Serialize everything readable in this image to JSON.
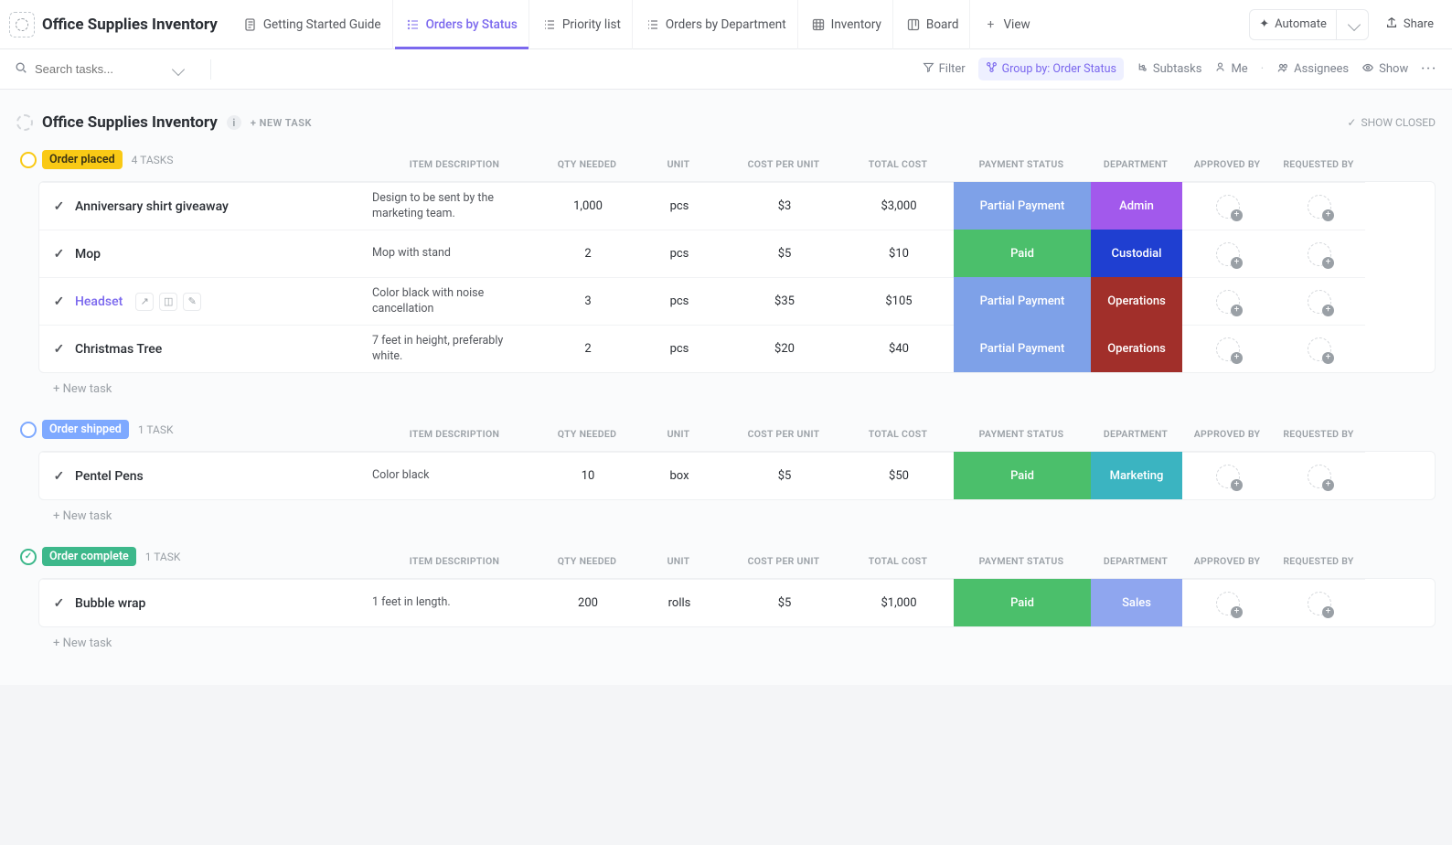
{
  "page_title": "Office Supplies Inventory",
  "tabs": [
    {
      "label": "Getting Started Guide",
      "active": false
    },
    {
      "label": "Orders by Status",
      "active": true
    },
    {
      "label": "Priority list",
      "active": false
    },
    {
      "label": "Orders by Department",
      "active": false
    },
    {
      "label": "Inventory",
      "active": false
    },
    {
      "label": "Board",
      "active": false
    }
  ],
  "add_view_label": "View",
  "top_right": {
    "automate": "Automate",
    "share": "Share"
  },
  "toolbar": {
    "search_placeholder": "Search tasks...",
    "filter": "Filter",
    "group_by": "Group by: Order Status",
    "subtasks": "Subtasks",
    "me": "Me",
    "assignees": "Assignees",
    "show": "Show"
  },
  "list": {
    "title": "Office Supplies Inventory",
    "new_task": "+ NEW TASK",
    "show_closed": "SHOW CLOSED"
  },
  "columns": {
    "name": "",
    "item_description": "ITEM DESCRIPTION",
    "qty_needed": "QTY NEEDED",
    "unit": "UNIT",
    "cost_per_unit": "COST PER UNIT",
    "total_cost": "TOTAL COST",
    "payment_status": "PAYMENT STATUS",
    "department": "DEPARTMENT",
    "approved_by": "APPROVED BY",
    "requested_by": "REQUESTED BY"
  },
  "new_task_row": "+ New task",
  "payment_colors": {
    "Partial Payment": "#7ea1e8",
    "Paid": "#4bbf6b"
  },
  "department_colors": {
    "Admin": "#a259ec",
    "Custodial": "#1f3fd1",
    "Operations": "#a12f2a",
    "Marketing": "#3bb4c1",
    "Sales": "#8fa6ef"
  },
  "groups": [
    {
      "status": "Order placed",
      "color": "yellow",
      "count_label": "4 TASKS",
      "tasks": [
        {
          "name": "Anniversary shirt giveaway",
          "desc": "Design to be sent by the marketing team.",
          "qty": "1,000",
          "unit": "pcs",
          "cpu": "$3",
          "total": "$3,000",
          "payment": "Partial Payment",
          "dept": "Admin"
        },
        {
          "name": "Mop",
          "desc": "Mop with stand",
          "qty": "2",
          "unit": "pcs",
          "cpu": "$5",
          "total": "$10",
          "payment": "Paid",
          "dept": "Custodial"
        },
        {
          "name": "Headset",
          "desc": "Color black with noise cancellation",
          "qty": "3",
          "unit": "pcs",
          "cpu": "$35",
          "total": "$105",
          "payment": "Partial Payment",
          "dept": "Operations",
          "hovered": true
        },
        {
          "name": "Christmas Tree",
          "desc": "7 feet in height, preferably white.",
          "qty": "2",
          "unit": "pcs",
          "cpu": "$20",
          "total": "$40",
          "payment": "Partial Payment",
          "dept": "Operations"
        }
      ]
    },
    {
      "status": "Order shipped",
      "color": "blue",
      "count_label": "1 TASK",
      "tasks": [
        {
          "name": "Pentel Pens",
          "desc": "Color black",
          "qty": "10",
          "unit": "box",
          "cpu": "$5",
          "total": "$50",
          "payment": "Paid",
          "dept": "Marketing"
        }
      ]
    },
    {
      "status": "Order complete",
      "color": "green",
      "count_label": "1 TASK",
      "tasks": [
        {
          "name": "Bubble wrap",
          "desc": "1 feet in length.",
          "qty": "200",
          "unit": "rolls",
          "cpu": "$5",
          "total": "$1,000",
          "payment": "Paid",
          "dept": "Sales"
        }
      ]
    }
  ]
}
